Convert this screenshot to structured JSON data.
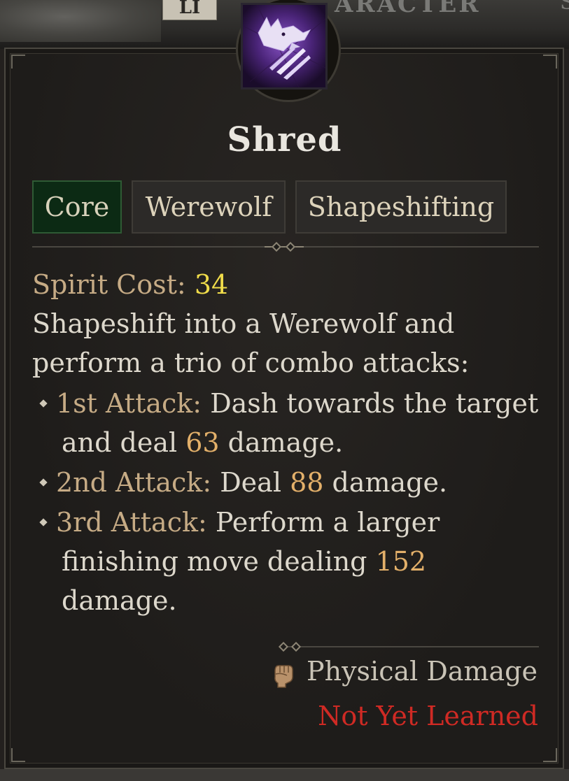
{
  "background": {
    "tab_label": "LI",
    "window_title": "ARACTER",
    "window_title_tail": "S"
  },
  "skill": {
    "name": "Shred",
    "icon": "werewolf-claw-icon",
    "tags": [
      "Core",
      "Werewolf",
      "Shapeshifting"
    ],
    "cost_label": "Spirit Cost:",
    "cost_value": "34",
    "description_line1": "Shapeshift into a Werewolf and",
    "description_line2": "perform a trio of combo attacks:",
    "attacks": [
      {
        "label": "1st Attack:",
        "text_before": " Dash towards the target",
        "text_line2_before": "and deal ",
        "value": "63",
        "text_after": " damage."
      },
      {
        "label": "2nd Attack:",
        "text_before": " Deal ",
        "value": "88",
        "text_after": " damage."
      },
      {
        "label": "3rd Attack:",
        "text_before": " Perform a larger",
        "text_line2_before": "finishing move dealing ",
        "value": "152",
        "text_line3": "damage."
      }
    ],
    "damage_type": "Physical Damage",
    "damage_icon": "fist-icon",
    "status": "Not Yet Learned"
  },
  "colors": {
    "core_tag_bg": "#0c2a14",
    "spirit_cost_value": "#f0dc4a",
    "damage_number": "#e3b06a",
    "status_red": "#cf2a24"
  }
}
